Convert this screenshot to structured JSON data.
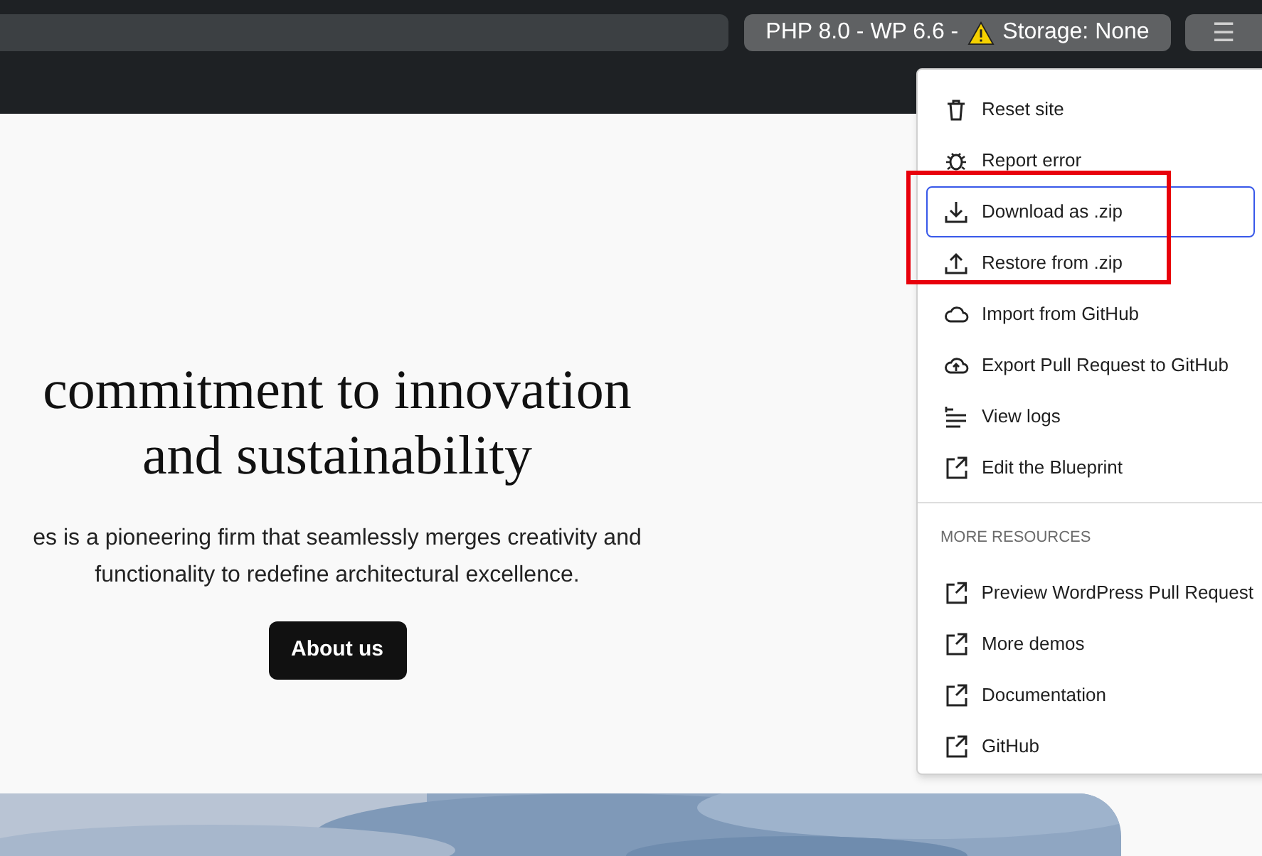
{
  "toolbar": {
    "environment": {
      "text_before": "PHP 8.0 - WP 6.6 -",
      "text_after": "Storage: None"
    },
    "menu_button": {
      "label": "☰",
      "expanded": true
    }
  },
  "page": {
    "heading": [
      "commitment to innovation",
      "and sustainability"
    ],
    "paragraph": [
      "es is a pioneering firm that seamlessly merges creativity and",
      "functionality to redefine architectural excellence."
    ],
    "button": "About us"
  },
  "menu": {
    "items": [
      {
        "label": "Reset site",
        "kind": "trash",
        "focused": false
      },
      {
        "label": "Report error",
        "kind": "bug",
        "focused": false
      },
      {
        "label": "Download as .zip",
        "kind": "download",
        "focused": true
      },
      {
        "label": "Restore from .zip",
        "kind": "upload",
        "focused": false
      },
      {
        "label": "Import from GitHub",
        "kind": "cloud",
        "focused": false
      },
      {
        "label": "Export Pull Request to GitHub",
        "kind": "cloud-upload",
        "focused": false
      },
      {
        "label": "View logs",
        "kind": "logs",
        "focused": false
      },
      {
        "label": "Edit the Blueprint",
        "kind": "external",
        "focused": false
      }
    ],
    "section_title": "MORE RESOURCES",
    "resources": [
      {
        "label": "Preview WordPress Pull Request",
        "kind": "external",
        "focused": false
      },
      {
        "label": "More demos",
        "kind": "external",
        "focused": false
      },
      {
        "label": "Documentation",
        "kind": "external",
        "focused": false
      },
      {
        "label": "GitHub",
        "kind": "external",
        "focused": false
      }
    ]
  },
  "annotation": {
    "kind": "highlight"
  }
}
